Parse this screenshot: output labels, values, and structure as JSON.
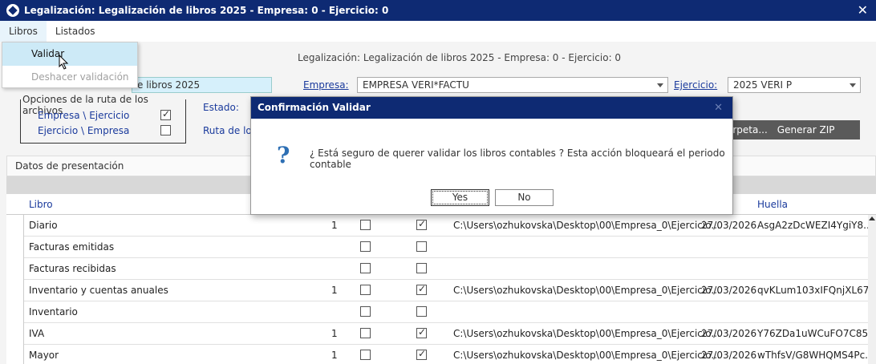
{
  "window": {
    "title": "Legalización: Legalización de libros 2025 - Empresa: 0 - Ejercicio: 0",
    "close": "✕"
  },
  "menu": {
    "items": [
      "Libros",
      "Listados"
    ]
  },
  "dropdown": {
    "validar": "Validar",
    "deshacer": "Deshacer validación"
  },
  "subtitle": "Legalización: Legalización de libros 2025 - Empresa: 0 - Ejercicio: 0",
  "form": {
    "libro_value": "e libros 2025",
    "empresa_label": "Empresa:",
    "empresa_value": "EMPRESA VERI*FACTU",
    "ejercicio_label": "Ejercicio:",
    "ejercicio_value": "2025 VERI P",
    "estado_label": "Estado:",
    "ruta_label": "Ruta de los"
  },
  "groupbox": {
    "legend": "Opciones de la ruta de los archivos",
    "opt1": "Empresa \\ Ejercicio",
    "opt2": "Ejercicio \\ Empresa"
  },
  "buttons": {
    "carpeta": "arpeta...",
    "zip": "Generar ZIP"
  },
  "datos_tab": "Datos de presentación",
  "table": {
    "headers": {
      "libro": "Libro",
      "huella": "Huella"
    },
    "rows": [
      {
        "libro": "Diario",
        "num": "1",
        "cb1": false,
        "cb2": true,
        "ruta": "C:\\Users\\ozhukovska\\Desktop\\00\\Empresa_0\\Ejercicio...",
        "fecha": "27/03/2026",
        "huella": "AsgA2zDcWEZI4YgiY8..."
      },
      {
        "libro": "Facturas emitidas",
        "num": "",
        "cb1": false,
        "cb2": false,
        "ruta": "",
        "fecha": "",
        "huella": ""
      },
      {
        "libro": "Facturas recibidas",
        "num": "",
        "cb1": false,
        "cb2": false,
        "ruta": "",
        "fecha": "",
        "huella": ""
      },
      {
        "libro": "Inventario y cuentas anuales",
        "num": "1",
        "cb1": false,
        "cb2": true,
        "ruta": "C:\\Users\\ozhukovska\\Desktop\\00\\Empresa_0\\Ejercicio...",
        "fecha": "27/03/2026",
        "huella": "qvKLum103xIFQnjXL67r..."
      },
      {
        "libro": "Inventario",
        "num": "",
        "cb1": false,
        "cb2": false,
        "ruta": "",
        "fecha": "",
        "huella": ""
      },
      {
        "libro": "IVA",
        "num": "1",
        "cb1": false,
        "cb2": true,
        "ruta": "C:\\Users\\ozhukovska\\Desktop\\00\\Empresa_0\\Ejercicio...",
        "fecha": "27/03/2026",
        "huella": "Y76ZDa1uWCuFO7C85..."
      },
      {
        "libro": "Mayor",
        "num": "1",
        "cb1": false,
        "cb2": true,
        "ruta": "C:\\Users\\ozhukovska\\Desktop\\00\\Empresa_0\\Ejercicio...",
        "fecha": "27/03/2026",
        "huella": "wThfsV/G8WHQMS4Pc..."
      }
    ]
  },
  "modal": {
    "title": "Confirmación Validar",
    "close": "✕",
    "icon": "?",
    "message": "¿ Está seguro de querer validar los libros contables ? Esta acción bloqueará el periodo contable",
    "yes": "Yes",
    "no": "No"
  }
}
